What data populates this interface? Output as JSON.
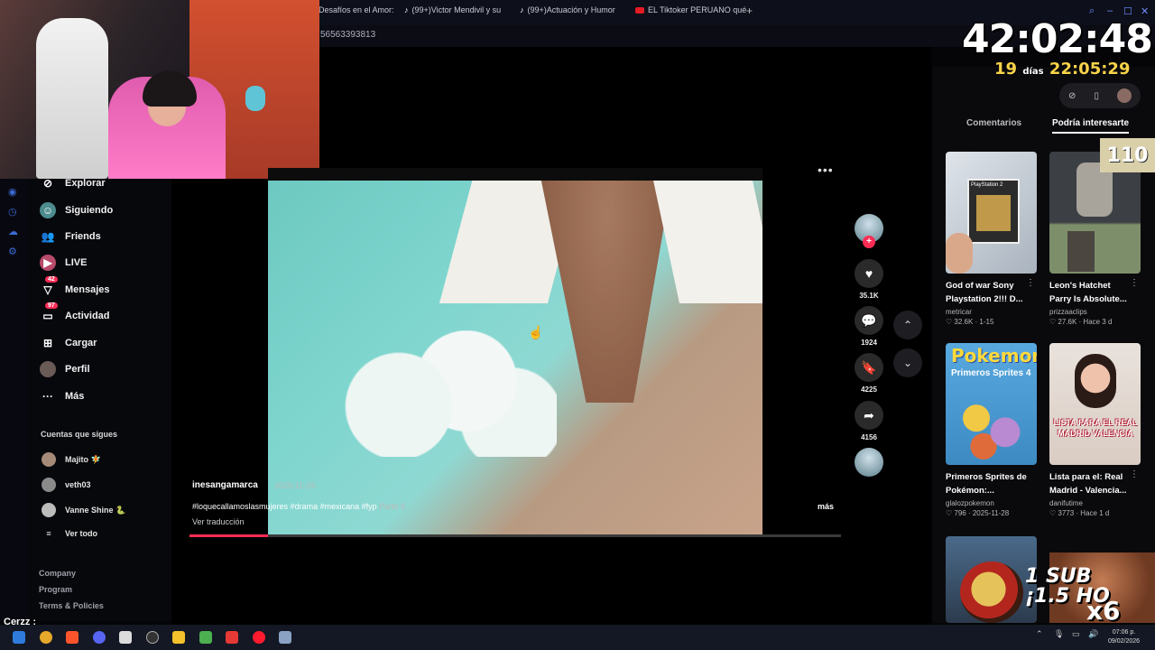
{
  "browser": {
    "tabs": [
      {
        "label": "Desafíos en el Amor:",
        "icon": "tiktok-icon"
      },
      {
        "label": "(99+)Victor Mendivil y su",
        "icon": "tiktok-icon"
      },
      {
        "label": "(99+)Actuación y Humor",
        "icon": "tiktok-icon"
      },
      {
        "label": "EL Tiktoker PERUANO qué",
        "icon": "youtube-icon"
      }
    ],
    "new_tab": "+",
    "address": "56563393813"
  },
  "sidebar": {
    "items": [
      {
        "label": "Explorar",
        "icon": "compass-icon"
      },
      {
        "label": "Siguiendo",
        "icon": "following-icon"
      },
      {
        "label": "Friends",
        "icon": "friends-icon"
      },
      {
        "label": "LIVE",
        "icon": "live-icon"
      },
      {
        "label": "Mensajes",
        "icon": "messages-icon",
        "badge": "42"
      },
      {
        "label": "Actividad",
        "icon": "activity-icon",
        "badge": "97"
      },
      {
        "label": "Cargar",
        "icon": "upload-icon"
      },
      {
        "label": "Perfil",
        "icon": "profile-icon"
      },
      {
        "label": "Más",
        "icon": "more-icon"
      }
    ],
    "following_title": "Cuentas que sigues",
    "following": [
      {
        "name": "Majito 🧚"
      },
      {
        "name": "veth03"
      },
      {
        "name": "Vanne Shine 🐍"
      }
    ],
    "see_all": "Ver todo",
    "footer": [
      "Company",
      "Program",
      "Terms & Policies"
    ]
  },
  "video": {
    "username": "inesangamarca",
    "date": "2025-11-25",
    "tags": "#loquecallamoslasmujeres #drama #mexicana #fyp",
    "part": "Parte 6",
    "translate": "Ver traducción",
    "more": "más",
    "progress": 0.12,
    "accent": "#fe2c55"
  },
  "actions": {
    "likes": "35.1K",
    "comments": "1924",
    "saves": "4225",
    "shares": "4156"
  },
  "panel": {
    "tabs": [
      "Comentarios",
      "Podría interesarte"
    ],
    "cards": [
      {
        "title": "God of war Sony Playstation 2!!! D...",
        "user": "metricar",
        "meta": "♡ 32.6K · 1-15"
      },
      {
        "title": "Leon's Hatchet Parry Is Absolute...",
        "user": "prizzaaclips",
        "meta": "♡ 27.6K · Hace 3 d"
      },
      {
        "title": "Primeros Sprites de Pokémon:...",
        "user": "glalozpokemon",
        "meta": "♡ 796 · 2025-11-28"
      },
      {
        "title": "Lista para el: Real Madrid - Valencia...",
        "user": "danifutime",
        "meta": "♡ 3773 · Hace 1 d"
      }
    ],
    "thumb_texts": {
      "ps2": "PlayStation 2",
      "pokemon_logo": "Pokemon",
      "pokemon_sub": "Primeros Sprites 4",
      "madrid": "LISTA PARA EL REAL MADRID VALENCIA"
    }
  },
  "overlay": {
    "timer": "42:02:48",
    "days": "19",
    "days_label": "días",
    "time": "22:05:29",
    "counter": "110",
    "sub_text_1": "1 SUB",
    "sub_text_2": "¡1.5 HO",
    "multiplier": "x6",
    "chat_user": "Cerzz :"
  },
  "taskbar": {
    "clock_time": "07:06 p.",
    "clock_date": "09/02/2026"
  }
}
